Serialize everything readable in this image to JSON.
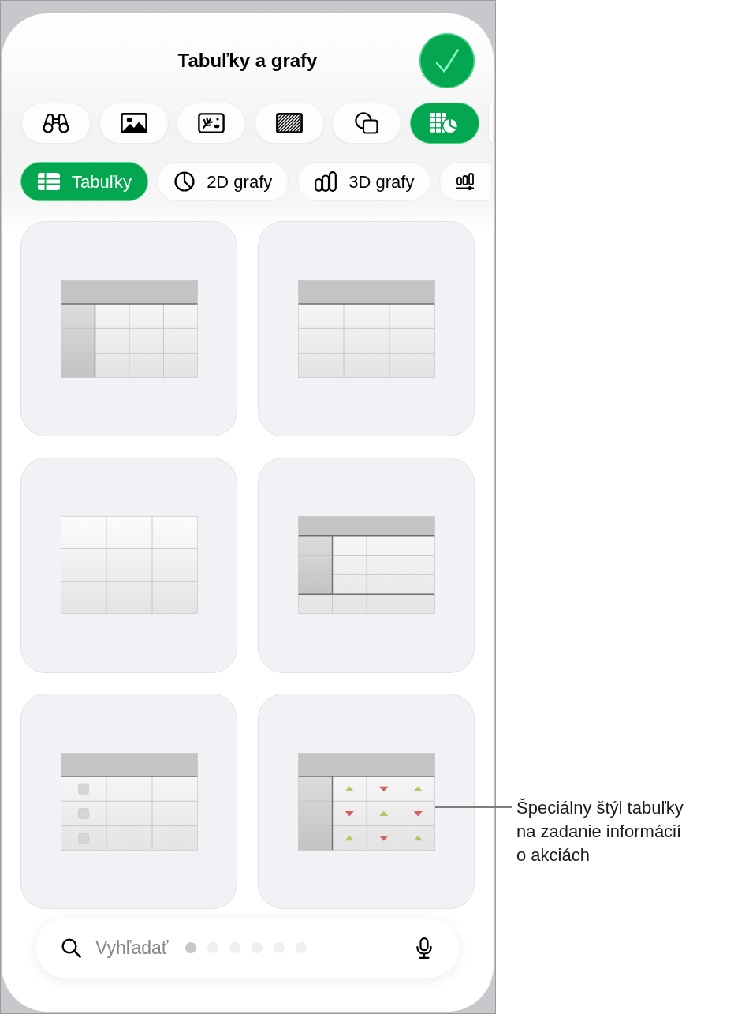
{
  "header": {
    "title": "Tabuľky a grafy"
  },
  "insert_tabs": [
    {
      "selected": false
    },
    {
      "selected": false
    },
    {
      "selected": false
    },
    {
      "selected": false
    },
    {
      "selected": false
    },
    {
      "selected": true
    },
    {
      "selected": false
    }
  ],
  "category_tabs": [
    {
      "label": "Tabuľky",
      "selected": true
    },
    {
      "label": "2D grafy",
      "selected": false
    },
    {
      "label": "3D grafy",
      "selected": false
    },
    {
      "selected": false
    }
  ],
  "table_styles": [
    {
      "kind": "basic"
    },
    {
      "kind": "header-row"
    },
    {
      "kind": "plain"
    },
    {
      "kind": "header-footer"
    },
    {
      "kind": "checkbox"
    },
    {
      "kind": "stock",
      "callout": "Špeciálny štýl tabuľky\nna zadanie informácií\no akciách"
    }
  ],
  "search": {
    "placeholder": "Vyhľadať"
  },
  "page_dots": [
    {
      "selected": true
    },
    {
      "selected": false
    },
    {
      "selected": false
    },
    {
      "selected": false
    },
    {
      "selected": false
    },
    {
      "selected": false
    }
  ]
}
